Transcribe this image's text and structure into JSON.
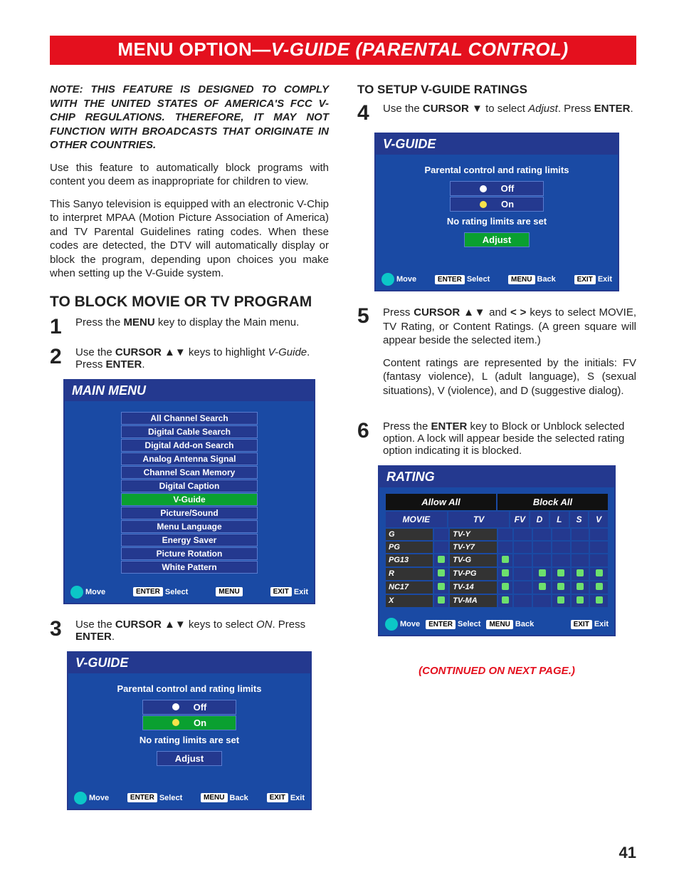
{
  "banner": {
    "left": "MENU OPTION—",
    "right": "V-GUIDE  (PARENTAL CONTROL)"
  },
  "note": "NOTE:   THIS FEATURE IS DESIGNED TO COMPLY WITH THE UNITED STATES OF AMERICA'S FCC V-CHIP REGULATIONS. THEREFORE, IT MAY NOT FUNCTION WITH BROADCASTS THAT ORIGINATE IN OTHER COUNTRIES.",
  "intro1": "Use this feature to automatically block programs with content you deem as inappropriate for children to view.",
  "intro2": "This Sanyo television is equipped with an electronic V-Chip to interpret MPAA (Motion Picture Association of America) and TV Parental Guidelines rating codes. When these codes are detected, the DTV will automatically display or block the program, depending upon choices you make when setting up the V-Guide system.",
  "h1": "TO BLOCK MOVIE OR TV PROGRAM",
  "steps": {
    "s1": {
      "pre": "Press the ",
      "k1": "MENU",
      "post": " key to display the Main menu."
    },
    "s2": {
      "pre": "Use the ",
      "k1": "CURSOR ▲▼",
      "mid": " keys to highlight ",
      "it": "V-Guide",
      "post": ". Press ",
      "k2": "ENTER",
      "end": "."
    },
    "s3": {
      "pre": "Use the ",
      "k1": "CURSOR ▲▼",
      "mid": " keys to select ",
      "it": "ON",
      "post": ". Press ",
      "k2": "ENTER",
      "end": "."
    },
    "s4": {
      "pre": "Use the ",
      "k1": "CURSOR ▼",
      "mid": " to select ",
      "it": "Adjust",
      "post": ". Press ",
      "k2": "ENTER",
      "end": "."
    },
    "s5": {
      "p1_pre": "Press ",
      "p1_k": "CURSOR ▲▼",
      "p1_mid": " and ",
      "p1_k2": "< >",
      "p1_post": " keys to select MOVIE, TV Rating, or Content Ratings. (A green square will appear beside the selected item.)",
      "p2": "Content ratings are represented by the initials: FV (fantasy violence), L (adult language), S (sexual situations), V (violence), and D (suggestive dialog)."
    },
    "s6": {
      "pre": "Press the ",
      "k1": "ENTER",
      "post": " key to Block or Unblock selected option. A lock will appear beside the selected rating option indicating it is blocked."
    }
  },
  "h2": "TO SETUP V-GUIDE RATINGS",
  "mainmenu": {
    "title": "MAIN MENU",
    "items": [
      "All Channel Search",
      "Digital Cable Search",
      "Digital Add-on Search",
      "Analog Antenna Signal",
      "Channel Scan Memory",
      "Digital Caption",
      "V-Guide",
      "Picture/Sound",
      "Menu Language",
      "Energy Saver",
      "Picture Rotation",
      "White Pattern"
    ],
    "sel": 6,
    "nav": {
      "move": "Move",
      "enter": "ENTER",
      "select": "Select",
      "menu": "MENU",
      "exit": "EXIT",
      "exitL": "Exit"
    }
  },
  "vguide": {
    "title": "V-GUIDE",
    "head": "Parental control and rating limits",
    "off": "Off",
    "on": "On",
    "none": "No rating limits are set",
    "adjust": "Adjust",
    "nav": {
      "move": "Move",
      "enter": "ENTER",
      "select": "Select",
      "menu": "MENU",
      "back": "Back",
      "exit": "EXIT",
      "exitL": "Exit"
    }
  },
  "rating": {
    "title": "RATING",
    "allow": "Allow All",
    "block": "Block All",
    "cols": [
      "MOVIE",
      "TV",
      "FV",
      "D",
      "L",
      "S",
      "V"
    ],
    "rows": [
      {
        "m": "G",
        "t": "TV-Y",
        "locks": [
          "",
          "",
          "",
          "",
          "",
          "",
          ""
        ]
      },
      {
        "m": "PG",
        "t": "TV-Y7",
        "locks": [
          "",
          "",
          "",
          "",
          "",
          "",
          ""
        ]
      },
      {
        "m": "PG13",
        "t": "TV-G",
        "locks": [
          "",
          "L",
          "",
          "L",
          "",
          "",
          "",
          ""
        ]
      },
      {
        "m": "R",
        "t": "TV-PG",
        "locks": [
          "",
          "L",
          "",
          "L",
          "",
          "L",
          "L",
          "L",
          "L"
        ]
      },
      {
        "m": "NC17",
        "t": "TV-14",
        "locks": [
          "",
          "L",
          "",
          "L",
          "",
          "L",
          "L",
          "L",
          "L"
        ]
      },
      {
        "m": "X",
        "t": "TV-MA",
        "locks": [
          "",
          "L",
          "",
          "L",
          "",
          "",
          "L",
          "L",
          "L"
        ]
      }
    ],
    "nav": {
      "move": "Move",
      "enter": "ENTER",
      "select": "Select",
      "menu": "MENU",
      "back": "Back",
      "exit": "EXIT",
      "exitL": "Exit"
    }
  },
  "continued": "(CONTINUED ON NEXT PAGE.)",
  "page": "41"
}
